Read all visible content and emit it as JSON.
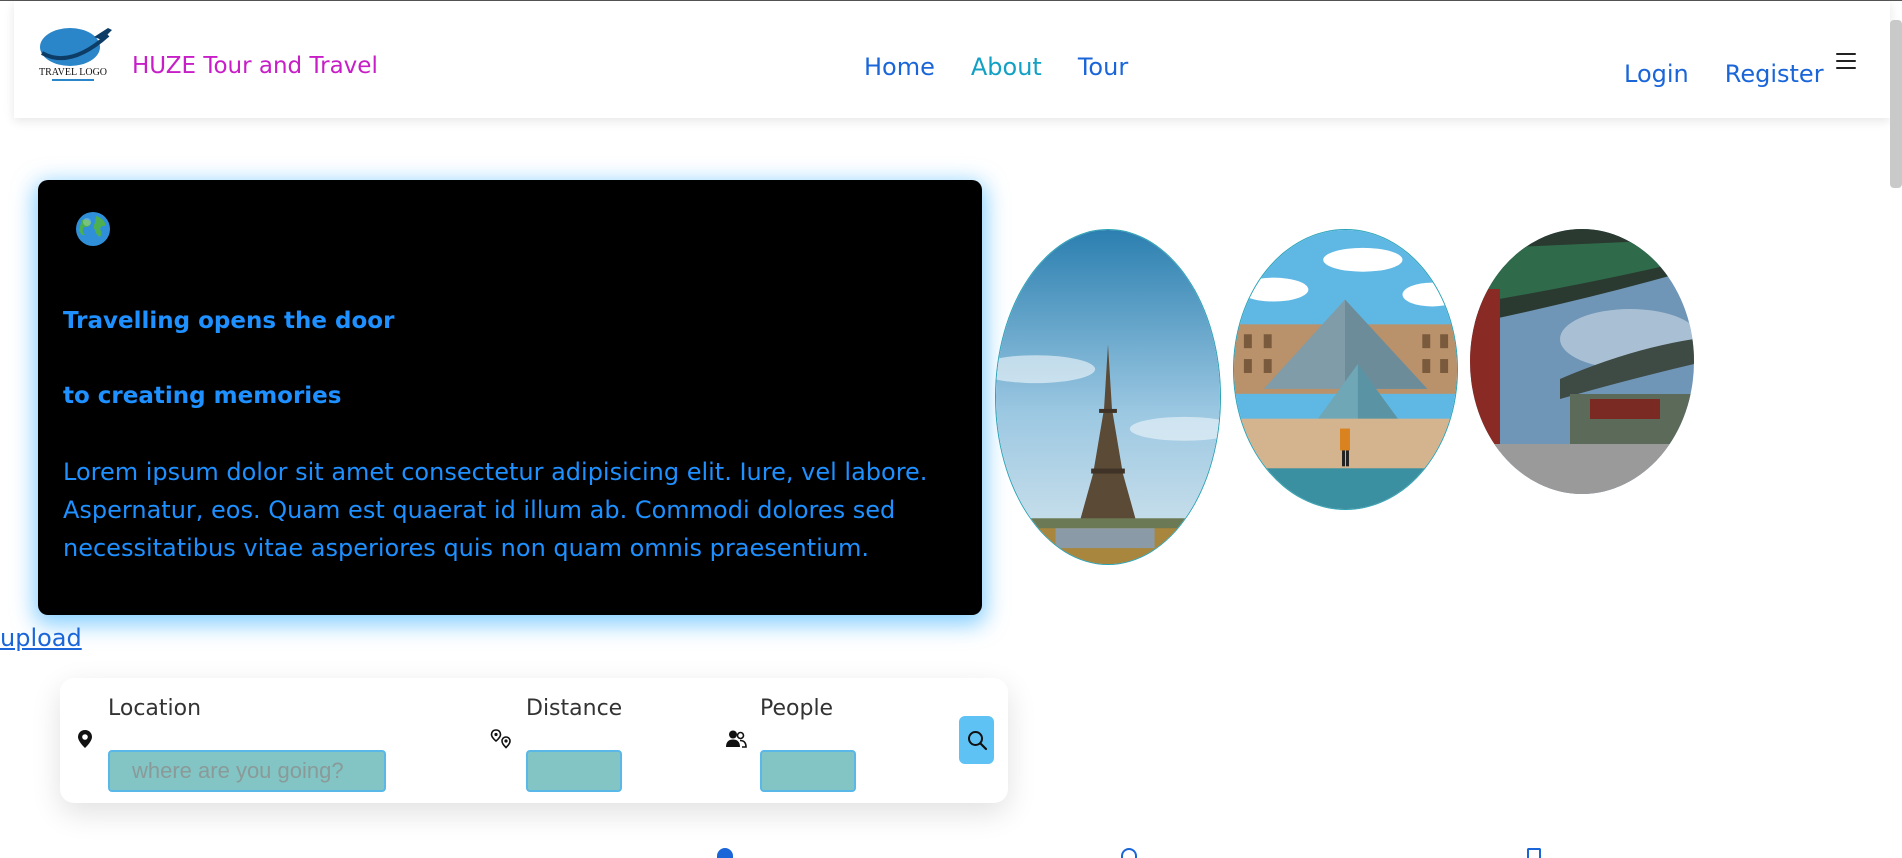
{
  "header": {
    "logo_text": "TRAVEL LOGO",
    "brand": "HUZE Tour and Travel",
    "nav": [
      {
        "label": "Home"
      },
      {
        "label": "About"
      },
      {
        "label": "Tour"
      }
    ],
    "login": "Login",
    "register": "Register",
    "menu_icon": "hamburger-icon"
  },
  "hero": {
    "icon": "globe-icon",
    "line1": "Travelling opens the door",
    "line2": "to creating memories",
    "body": "Lorem ipsum dolor sit amet consectetur adipisicing elit. Iure, vel labore. Aspernatur, eos. Quam est quaerat id illum ab. Commodi dolores sed necessitatibus vitae asperiores quis non quam omnis praesentium."
  },
  "gallery": [
    {
      "subject": "Eiffel Tower"
    },
    {
      "subject": "Louvre Pyramid"
    },
    {
      "subject": "Asian Palace Roof"
    }
  ],
  "upload_link": "upload",
  "search": {
    "location": {
      "label": "Location",
      "placeholder": "where are you going?",
      "icon": "map-pin-icon"
    },
    "distance": {
      "label": "Distance",
      "placeholder": "",
      "icon": "route-pins-icon"
    },
    "people": {
      "label": "People",
      "placeholder": "",
      "icon": "people-icon"
    },
    "button_icon": "search-icon"
  },
  "colors": {
    "brand": "#c71ec7",
    "nav_link": "#1a66d9",
    "nav_active": "#12a0c4",
    "hero_text": "#1e90ff",
    "hero_glow": "#28aaff",
    "input_bg": "#82c5c4",
    "search_btn": "#5ec2f5"
  }
}
